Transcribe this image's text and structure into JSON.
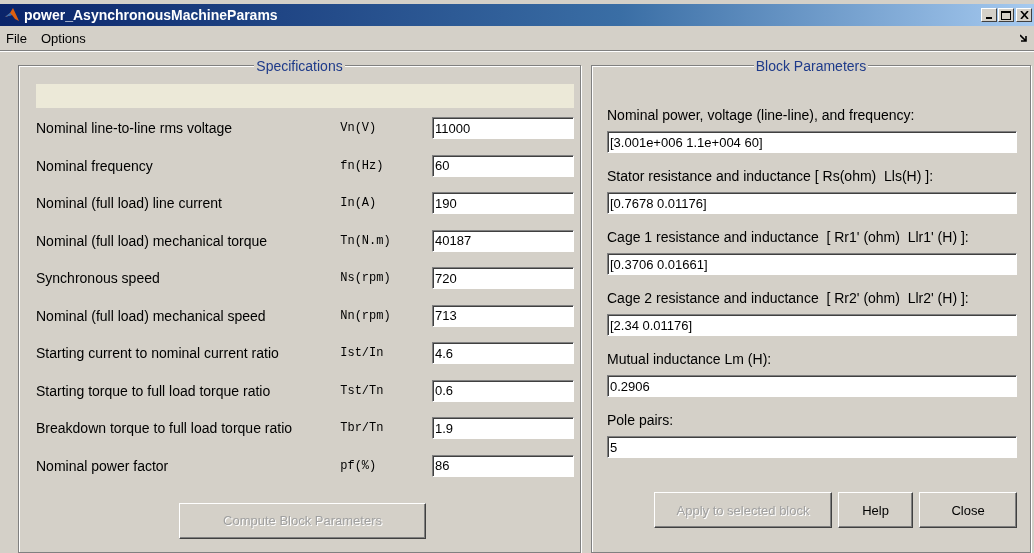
{
  "window": {
    "title": "power_AsynchronousMachineParams"
  },
  "menu": [
    {
      "label": "File"
    },
    {
      "label": "Options"
    }
  ],
  "specifications": {
    "title": "Specifications",
    "rows": [
      {
        "label": "Nominal line-to-line rms voltage",
        "symbol": "Vn(V)",
        "value": "11000"
      },
      {
        "label": "Nominal frequency",
        "symbol": "fn(Hz)",
        "value": "60"
      },
      {
        "label": "Nominal (full load) line current",
        "symbol": "In(A)",
        "value": "190"
      },
      {
        "label": "Nominal (full load) mechanical torque",
        "symbol": "Tn(N.m)",
        "value": "40187"
      },
      {
        "label": "Synchronous speed",
        "symbol": "Ns(rpm)",
        "value": "720"
      },
      {
        "label": "Nominal (full load) mechanical speed",
        "symbol": "Nn(rpm)",
        "value": "713"
      },
      {
        "label": "Starting current to nominal current ratio",
        "symbol": "Ist/In",
        "value": "4.6"
      },
      {
        "label": "Starting torque to full load torque ratio",
        "symbol": "Tst/Tn",
        "value": "0.6"
      },
      {
        "label": "Breakdown torque to full load torque ratio",
        "symbol": "Tbr/Tn",
        "value": "1.9"
      },
      {
        "label": "Nominal power factor",
        "symbol": "pf(%)",
        "value": "86"
      }
    ],
    "button": {
      "label": "Compute Block Parameters",
      "disabled": true
    }
  },
  "block_parameters": {
    "title": "Block Parameters",
    "fields": [
      {
        "label": "Nominal power, voltage (line-line), and frequency:",
        "value": "[3.001e+006 1.1e+004 60]"
      },
      {
        "label": "Stator resistance and inductance [ Rs(ohm)  Lls(H) ]:",
        "value": "[0.7678 0.01176]"
      },
      {
        "label": "Cage 1 resistance and inductance  [ Rr1' (ohm)  Llr1' (H) ]:",
        "value": "[0.3706 0.01661]"
      },
      {
        "label": "Cage 2 resistance and inductance  [ Rr2' (ohm)  Llr2' (H) ]:",
        "value": "[2.34 0.01176]"
      },
      {
        "label": "Mutual inductance Lm (H):",
        "value": "0.2906"
      },
      {
        "label": "Pole pairs:",
        "value": "5"
      }
    ],
    "buttons": [
      {
        "label": "Apply to selected block",
        "disabled": true
      },
      {
        "label": "Help",
        "disabled": false
      },
      {
        "label": "Close",
        "disabled": false
      }
    ]
  }
}
